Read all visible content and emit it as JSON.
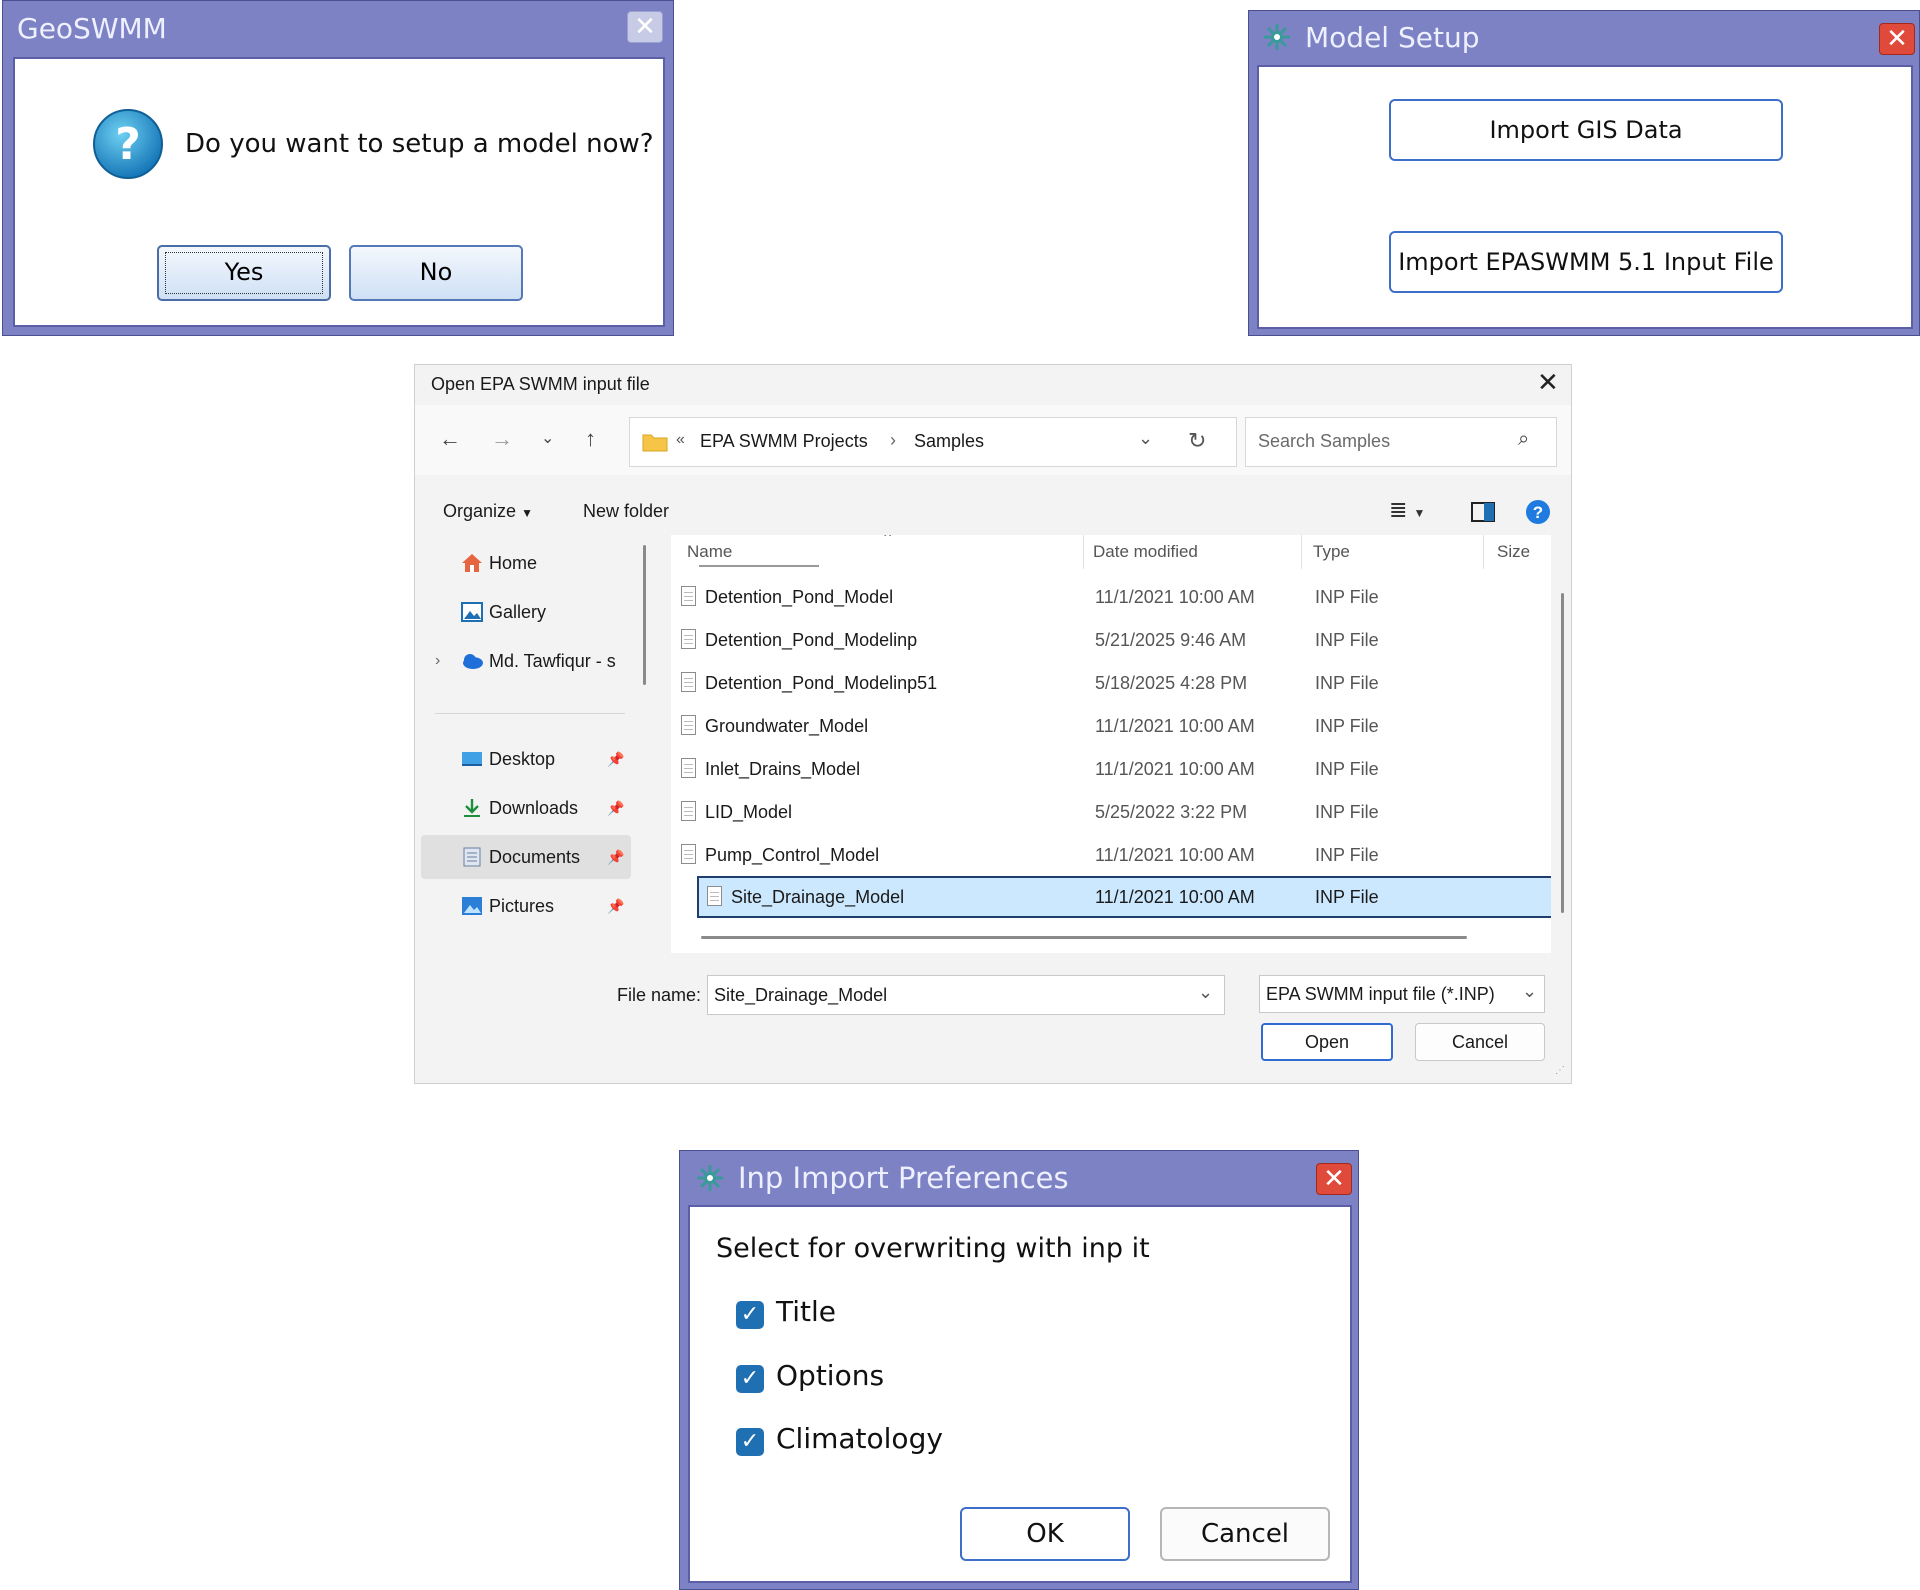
{
  "geoswmm_dialog": {
    "title": "GeoSWMM",
    "close_glyph": "✕",
    "message": "Do you want to setup a model now?",
    "icon": "question-icon",
    "yes_label": "Yes",
    "no_label": "No"
  },
  "model_setup_dialog": {
    "title": "Model Setup",
    "close_glyph": "✕",
    "import_gis_label": "Import GIS Data",
    "import_inp_label": "Import EPASWMM 5.1 Input File"
  },
  "file_dialog": {
    "title": "Open EPA SWMM input file",
    "breadcrumb": [
      "EPA SWMM Projects",
      "Samples"
    ],
    "breadcrumb_prefix": "«",
    "search_placeholder": "Search Samples",
    "organize_label": "Organize",
    "new_folder_label": "New folder",
    "nav": {
      "top": [
        {
          "label": "Home",
          "icon": "home-icon"
        },
        {
          "label": "Gallery",
          "icon": "gallery-icon"
        },
        {
          "label": "Md. Tawfiqur - s",
          "icon": "onedrive-icon"
        }
      ],
      "quick": [
        {
          "label": "Desktop",
          "icon": "desktop-icon"
        },
        {
          "label": "Downloads",
          "icon": "download-icon"
        },
        {
          "label": "Documents",
          "icon": "documents-icon",
          "selected": true
        },
        {
          "label": "Pictures",
          "icon": "pictures-icon"
        }
      ]
    },
    "columns": {
      "name": "Name",
      "date": "Date modified",
      "type": "Type",
      "size": "Size"
    },
    "files": [
      {
        "name": "Detention_Pond_Model",
        "date": "11/1/2021 10:00 AM",
        "type": "INP File"
      },
      {
        "name": "Detention_Pond_Modelinp",
        "date": "5/21/2025 9:46 AM",
        "type": "INP File"
      },
      {
        "name": "Detention_Pond_Modelinp51",
        "date": "5/18/2025 4:28 PM",
        "type": "INP File"
      },
      {
        "name": "Groundwater_Model",
        "date": "11/1/2021 10:00 AM",
        "type": "INP File"
      },
      {
        "name": "Inlet_Drains_Model",
        "date": "11/1/2021 10:00 AM",
        "type": "INP File"
      },
      {
        "name": "LID_Model",
        "date": "5/25/2022 3:22 PM",
        "type": "INP File"
      },
      {
        "name": "Pump_Control_Model",
        "date": "11/1/2021 10:00 AM",
        "type": "INP File"
      },
      {
        "name": "Site_Drainage_Model",
        "date": "11/1/2021 10:00 AM",
        "type": "INP File",
        "selected": true
      }
    ],
    "file_name_label": "File name:",
    "file_name_value": "Site_Drainage_Model",
    "file_type_value": "EPA SWMM input file (*.INP)",
    "open_label": "Open",
    "cancel_label": "Cancel"
  },
  "inp_prefs_dialog": {
    "title": "Inp Import Preferences",
    "close_glyph": "✕",
    "instruction": "Select for overwriting with inp it",
    "options": [
      {
        "label": "Title",
        "checked": true
      },
      {
        "label": "Options",
        "checked": true
      },
      {
        "label": "Climatology",
        "checked": true
      }
    ],
    "ok_label": "OK",
    "cancel_label": "Cancel"
  },
  "colors": {
    "classic_frame": "#7c82c4",
    "selection": "#cce8ff",
    "accent_blue": "#1f6fb3",
    "close_red": "#e04a3a"
  }
}
